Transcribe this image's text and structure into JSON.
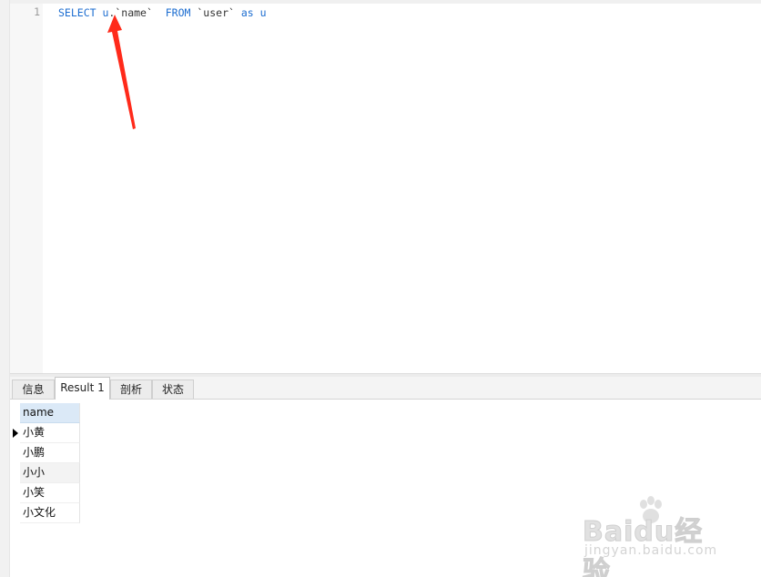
{
  "editor": {
    "line_numbers": [
      "1"
    ],
    "code_tokens": [
      {
        "text": "SELECT",
        "kind": "kw"
      },
      {
        "text": " ",
        "kind": "str"
      },
      {
        "text": "u",
        "kind": "id"
      },
      {
        "text": ".`name`",
        "kind": "str"
      },
      {
        "text": "  ",
        "kind": "str"
      },
      {
        "text": "FROM",
        "kind": "kw"
      },
      {
        "text": " `user` ",
        "kind": "str"
      },
      {
        "text": "as",
        "kind": "kw"
      },
      {
        "text": " u",
        "kind": "id"
      }
    ]
  },
  "annotation": {
    "arrow_color": "#ff2a1a"
  },
  "tabs": [
    {
      "label": "信息",
      "active": false
    },
    {
      "label": "Result 1",
      "active": true
    },
    {
      "label": "剖析",
      "active": false
    },
    {
      "label": "状态",
      "active": false
    }
  ],
  "result_grid": {
    "columns": [
      "name"
    ],
    "rows": [
      [
        "小黄"
      ],
      [
        "小鹏"
      ],
      [
        "小小"
      ],
      [
        "小笑"
      ],
      [
        "小文化"
      ]
    ],
    "current_row_index": 0
  },
  "watermark": {
    "brand": "Baidu经验",
    "url": "jingyan.baidu.com"
  },
  "colors": {
    "keyword": "#1c6dd0",
    "header_bg": "#dbe9f7",
    "arrow": "#ff2a1a"
  }
}
